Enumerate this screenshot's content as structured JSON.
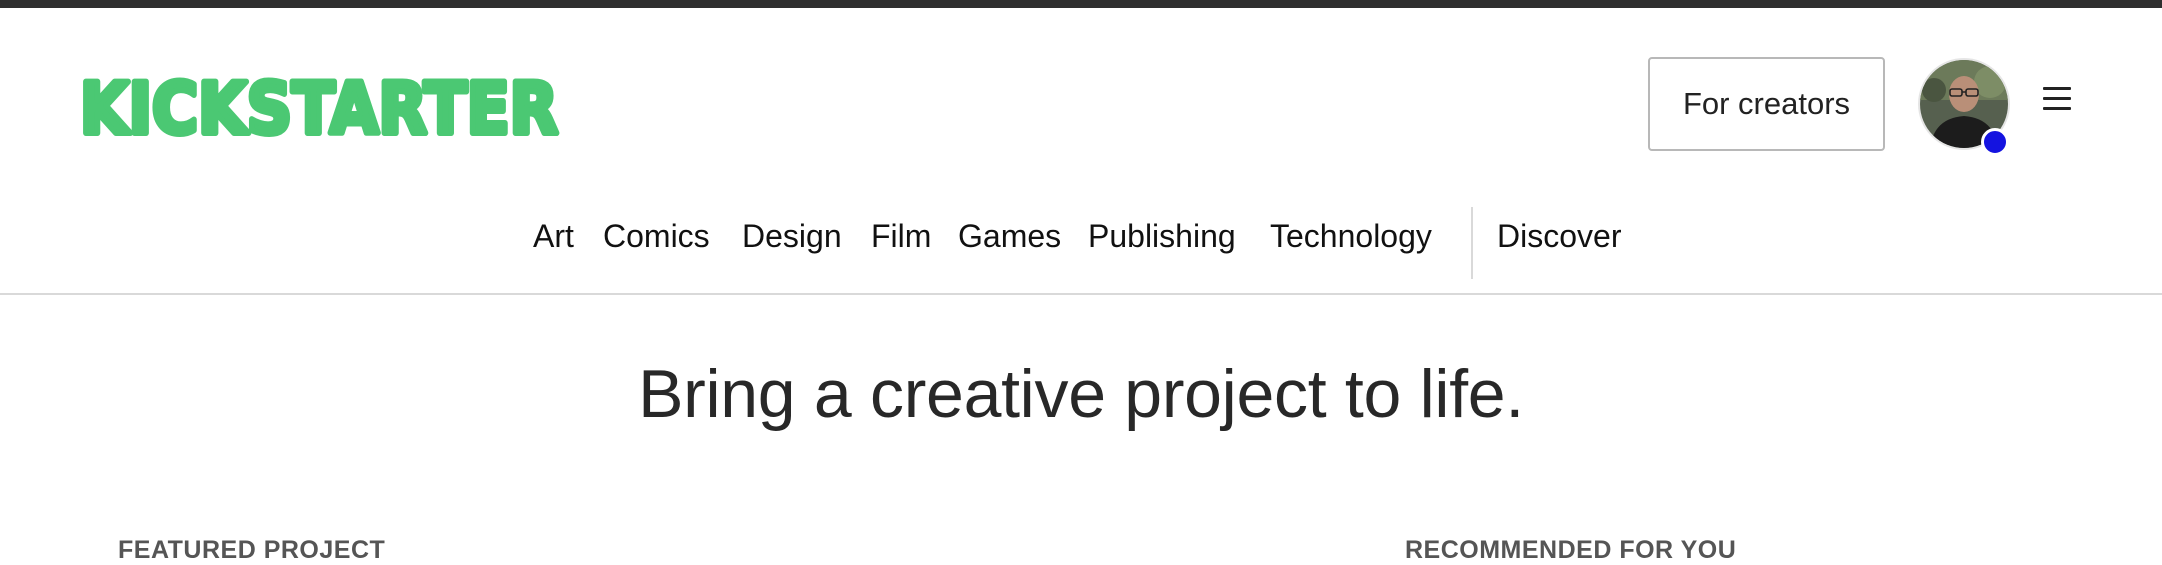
{
  "header": {
    "logo_text": "KICKSTARTER",
    "brand_color": "#05ce78",
    "for_creators_label": "For creators",
    "notification_dot_color": "#1413e0"
  },
  "nav": {
    "items": [
      "Art",
      "Comics",
      "Design",
      "Film",
      "Games",
      "Publishing",
      "Technology"
    ],
    "discover_label": "Discover"
  },
  "main": {
    "headline": "Bring a creative project to life.",
    "featured_label": "FEATURED PROJECT",
    "recommended_label": "RECOMMENDED FOR YOU"
  }
}
